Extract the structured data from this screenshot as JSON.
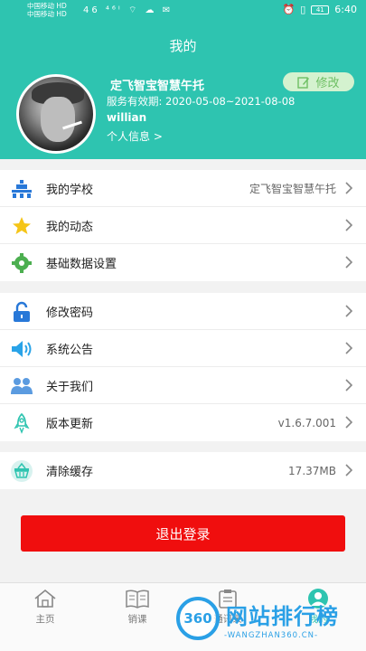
{
  "statusbar": {
    "carrier1": "中国移动 HD",
    "carrier2": "中国移动 HD",
    "network": "46 ⁴⁶ᴵ",
    "battery": "41",
    "time": "6:40"
  },
  "header": {
    "title": "我的",
    "school_name": "定飞智宝智慧午托",
    "edit_label": "修改",
    "service_period": "服务有效期: 2020-05-08~2021-08-08",
    "username": "willian",
    "profile_link": "个人信息 >"
  },
  "menu_group1": [
    {
      "label": "我的学校",
      "value": "定飞智宝智慧午托",
      "icon": "school-icon"
    },
    {
      "label": "我的动态",
      "value": "",
      "icon": "star-icon"
    },
    {
      "label": "基础数据设置",
      "value": "",
      "icon": "gear-icon"
    }
  ],
  "menu_group2": [
    {
      "label": "修改密码",
      "value": "",
      "icon": "unlock-icon"
    },
    {
      "label": "系统公告",
      "value": "",
      "icon": "speaker-icon"
    },
    {
      "label": "关于我们",
      "value": "",
      "icon": "people-icon"
    },
    {
      "label": "版本更新",
      "value": "v1.6.7.001",
      "icon": "rocket-icon"
    }
  ],
  "menu_group3": [
    {
      "label": "清除缓存",
      "value": "17.37MB",
      "icon": "basket-icon"
    }
  ],
  "logout_label": "退出登录",
  "tabs": [
    {
      "label": "主页",
      "icon": "home-icon"
    },
    {
      "label": "销课",
      "icon": "book-icon"
    },
    {
      "label": "通讯录",
      "icon": "clipboard-icon"
    },
    {
      "label": "我的",
      "icon": "user-icon"
    }
  ],
  "watermark": {
    "badge": "360",
    "title": "网站排行榜",
    "url": "-WANGZHAN360.CN-"
  },
  "colors": {
    "brand": "#2ec4b0",
    "logout": "#f00e0e",
    "edit_bg": "#d4f2cf",
    "watermark": "#2aa0e6"
  }
}
